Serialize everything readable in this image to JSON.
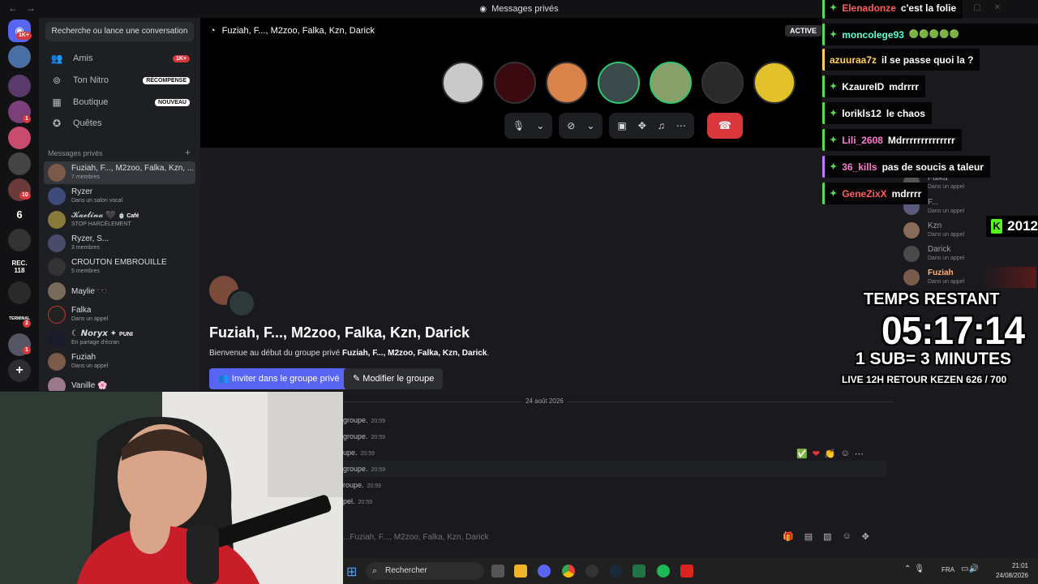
{
  "titlebar": {
    "title": "Messages privés"
  },
  "servers": {
    "badges": [
      "1K+",
      "1",
      "10",
      "1",
      "2",
      "1"
    ],
    "text_items": [
      "6",
      "REC.\n118",
      "TERMINAL"
    ]
  },
  "sidebar": {
    "search_label": "Recherche ou lance une conversation",
    "nav": [
      {
        "label": "Amis",
        "badge": "1K+"
      },
      {
        "label": "Ton Nitro",
        "badge": "RÉCOMPENSE"
      },
      {
        "label": "Boutique",
        "badge": "NOUVEAU"
      },
      {
        "label": "Quêtes",
        "badge": ""
      }
    ],
    "dm_header": "Messages privés",
    "dms": [
      {
        "name": "Fuziah, F..., M2zoo, Falka, Kzn, ...",
        "sub": "7 membres"
      },
      {
        "name": "Ryzer",
        "sub": "Dans un salon vocal"
      },
      {
        "name": "𝓚𝓪𝓮𝓵𝓲𝓷𝓪 🖤",
        "tag": "🍵 Café",
        "sub": "STOP HARCÈLEMENT"
      },
      {
        "name": "Ryzer, S...",
        "sub": "3 membres"
      },
      {
        "name": "CROUTON EMBROUILLE",
        "sub": "5 membres"
      },
      {
        "name": "Maylie 🕶️",
        "sub": ""
      },
      {
        "name": "Falka",
        "sub": "Dans un appel"
      },
      {
        "name": "☾ 𝙉𝙤𝙧𝙮𝙭 ✦",
        "tag": "PUNI",
        "sub": "En partage d'écran"
      },
      {
        "name": "Fuziah",
        "sub": "Dans un appel"
      },
      {
        "name": "Vanille 🌸",
        "sub": ""
      }
    ]
  },
  "call": {
    "title": "Fuziah, F..., M2zoo, Falka, Kzn, Darick",
    "active_label": "ACTIVE",
    "participants": 7
  },
  "chat": {
    "group_title": "Fuziah, F..., M2zoo, Falka, Kzn, Darick",
    "welcome_prefix": "Bienvenue au début du groupe privé ",
    "welcome_name": "Fuziah, F..., M2zoo, Falka, Kzn, Darick",
    "welcome_suffix": ".",
    "invite_label": "Inviter dans le groupe privé",
    "edit_label": "Modifier le groupe",
    "date": "24 août 2026",
    "messages": [
      {
        "text": "groupe.",
        "time": "20:59"
      },
      {
        "text": "groupe.",
        "time": "20:59"
      },
      {
        "text": "upe.",
        "time": "20:59"
      },
      {
        "text": "groupe.",
        "time": "20:59"
      },
      {
        "text": "roupe.",
        "time": "20:59"
      },
      {
        "text": "pel.",
        "time": "20:59"
      }
    ],
    "input_placeholder": "...Fuziah, F..., M2zoo, Falka, Kzn, Darick"
  },
  "members": [
    {
      "name": "Falka",
      "sub": "Dans un appel"
    },
    {
      "name": "F...",
      "sub": "Dans un appel"
    },
    {
      "name": "Kzn",
      "sub": "Dans un appel"
    },
    {
      "name": "Darick",
      "sub": "Dans un appel"
    },
    {
      "name": "Fuziah",
      "sub": "Dans un appel"
    }
  ],
  "stream_chat": [
    {
      "user": "Elenadonze",
      "msg": "c'est la folie",
      "color": "#ff5c5c",
      "border": "#55dd55"
    },
    {
      "user": "moncolege93",
      "msg": "",
      "color": "#55ffd0",
      "border": "#55dd55",
      "emotes": "🟢🟢🟢🟢🟢"
    },
    {
      "user": "azuuraa7z",
      "msg": "il se passe quoi la ?",
      "color": "#ffd15c",
      "border": "#ffd15c"
    },
    {
      "user": "KzaureID",
      "msg": "mdrrrr",
      "color": "#ffffff",
      "border": "#55dd55"
    },
    {
      "user": "lorikls12",
      "msg": "le chaos",
      "color": "#ffffff",
      "border": "#55dd55"
    },
    {
      "user": "Lili_2608",
      "msg": "Mdrrrrrrrrrrrrrr",
      "color": "#ff7ad0",
      "border": "#55dd55"
    },
    {
      "user": "36_kills",
      "msg": "pas de soucis a taleur",
      "color": "#ff7ad0",
      "border": "#c07aff"
    },
    {
      "user": "GeneZixX",
      "msg": "mdrrrr",
      "color": "#ff5c5c",
      "border": "#55dd55"
    }
  ],
  "kick_counter": {
    "icon": "K",
    "value": "2012"
  },
  "overlay": {
    "line1": "TEMPS RESTANT",
    "timer": "05:17:14",
    "line3": "1 SUB= 3 MINUTES",
    "line4": "LIVE 12H RETOUR KEZEN 626 / 700"
  },
  "taskbar": {
    "search_label": "Rechercher",
    "lang": "FRA",
    "time": "21:01",
    "date": "24/08/2026"
  }
}
